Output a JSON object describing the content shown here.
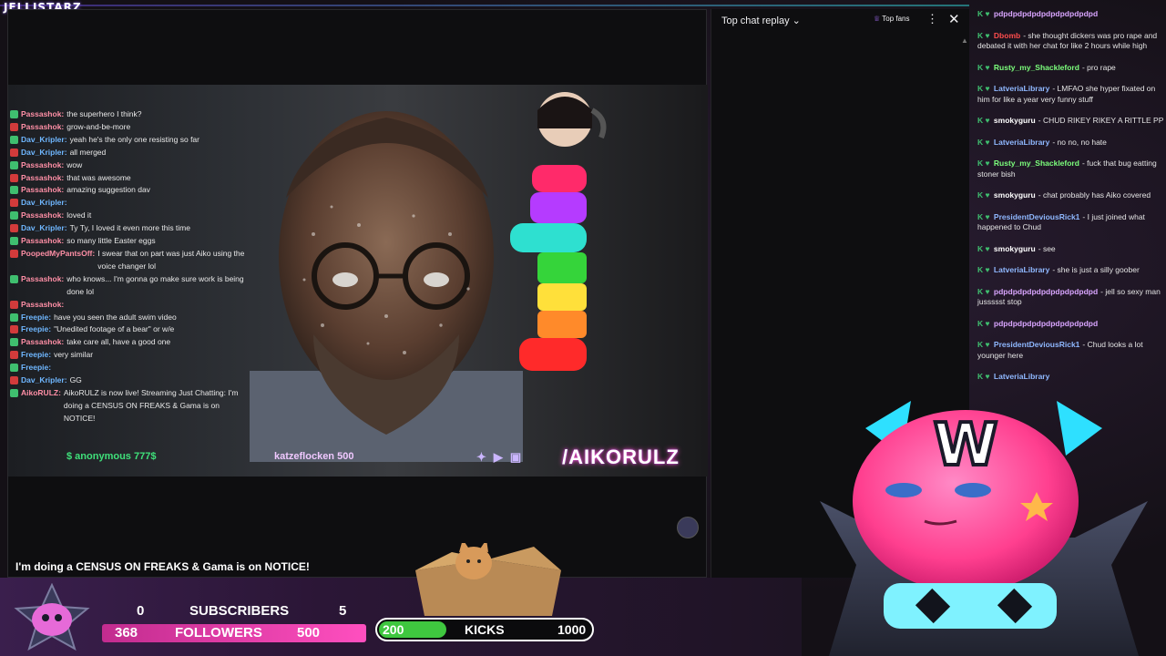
{
  "brand": "JELLISTARZ",
  "overlay_chat": [
    {
      "user": "Passashok:",
      "text": "the superhero I think?",
      "c": "pink"
    },
    {
      "user": "Passashok:",
      "text": "grow-and-be-more",
      "c": "pink"
    },
    {
      "user": "Dav_Kripler:",
      "text": "yeah he's the only one resisting so far",
      "c": "blue"
    },
    {
      "user": "Dav_Kripler:",
      "text": "all merged",
      "c": "blue"
    },
    {
      "user": "Passashok:",
      "text": "wow",
      "c": "pink"
    },
    {
      "user": "Passashok:",
      "text": "that was awesome",
      "c": "pink"
    },
    {
      "user": "Passashok:",
      "text": "amazing suggestion dav",
      "c": "pink"
    },
    {
      "user": "Dav_Kripler:",
      "text": "",
      "c": "blue"
    },
    {
      "user": "Passashok:",
      "text": "loved it",
      "c": "pink"
    },
    {
      "user": "Dav_Kripler:",
      "text": "Ty Ty, I loved it even more this time",
      "c": "blue"
    },
    {
      "user": "Passashok:",
      "text": "so many little Easter eggs",
      "c": "pink"
    },
    {
      "user": "PoopedMyPantsOff:",
      "text": "I swear that on part was just Aiko using the voice changer lol",
      "c": "pink"
    },
    {
      "user": "Passashok:",
      "text": "who knows... I'm gonna go make sure work is being done lol",
      "c": "pink"
    },
    {
      "user": "Passashok:",
      "text": "",
      "c": "pink"
    },
    {
      "user": "Freepie:",
      "text": "have you seen the adult swim video",
      "c": "blue"
    },
    {
      "user": "Freepie:",
      "text": "\"Unedited footage of a bear\" or w/e",
      "c": "blue"
    },
    {
      "user": "Passashok:",
      "text": "take care all, have a good one",
      "c": "pink"
    },
    {
      "user": "Freepie:",
      "text": "very similar",
      "c": "blue"
    },
    {
      "user": "Freepie:",
      "text": "",
      "c": "blue"
    },
    {
      "user": "Dav_Kripler:",
      "text": "GG",
      "c": "blue"
    },
    {
      "user": "AikoRULZ:",
      "text": "AikoRULZ is now live! Streaming Just Chatting: I'm doing a CENSUS ON FREAKS & Gama is on NOTICE!",
      "c": "pink"
    }
  ],
  "ticker": {
    "donor1": "$ anonymous 777$",
    "donor2": "katzeflocken 500",
    "handle": "/AIKORULZ"
  },
  "stream_title": "I'm doing a CENSUS ON FREAKS & Gama is on NOTICE!",
  "replay": {
    "title": "Top chat replay",
    "top_fans": "Top fans"
  },
  "right_chat": [
    {
      "user": "pdpdpdpdpdpdpdpdpdpdpd",
      "text": "",
      "color": "#d9a5ff"
    },
    {
      "user": "Dbomb",
      "text": "- she thought dickers was pro rape and debated it with her chat for like 2 hours while high",
      "color": "#ff4d4d"
    },
    {
      "user": "Rusty_my_Shackleford",
      "text": "- pro rape",
      "color": "#7cff7c"
    },
    {
      "user": "LatveriaLibrary",
      "text": "- LMFAO she hyper fixated on him for like a year very funny stuff",
      "color": "#8fb8ff"
    },
    {
      "user": "smokyguru",
      "text": "- CHUD RIKEY RIKEY A RITTLE PP",
      "color": "#ffffff"
    },
    {
      "user": "LatveriaLibrary",
      "text": "- no no, no hate",
      "color": "#8fb8ff"
    },
    {
      "user": "Rusty_my_Shackleford",
      "text": "- fuck that bug eatting stoner bish",
      "color": "#7cff7c"
    },
    {
      "user": "smokyguru",
      "text": "- chat probably has Aiko covered",
      "color": "#ffffff"
    },
    {
      "user": "PresidentDeviousRick1",
      "text": "- I just joined what happened to Chud",
      "color": "#8fb8ff"
    },
    {
      "user": "smokyguru",
      "text": "- see",
      "color": "#ffffff"
    },
    {
      "user": "LatveriaLibrary",
      "text": "- she is just a silly goober",
      "color": "#8fb8ff"
    },
    {
      "user": "pdpdpdpdpdpdpdpdpdpdpd",
      "text": "- jell so sexy man jussssst stop",
      "color": "#d9a5ff"
    },
    {
      "user": "pdpdpdpdpdpdpdpdpdpdpd",
      "text": "",
      "color": "#d9a5ff"
    },
    {
      "user": "PresidentDeviousRick1",
      "text": "- Chud looks a lot younger here",
      "color": "#8fb8ff"
    },
    {
      "user": "LatveriaLibrary",
      "text": "",
      "color": "#8fb8ff"
    }
  ],
  "stats": {
    "subs_current": "0",
    "subs_label": "SUBSCRIBERS",
    "subs_goal": "5",
    "fol_current": "368",
    "fol_label": "FOLLOWERS",
    "fol_goal": "500",
    "kicks_current": "200",
    "kicks_label": "KICKS",
    "kicks_goal": "1000",
    "kicks_progress": 0.2
  },
  "icons": {
    "close": "close-icon",
    "menu": "kebab-icon",
    "chevron": "chevron-down-icon"
  }
}
